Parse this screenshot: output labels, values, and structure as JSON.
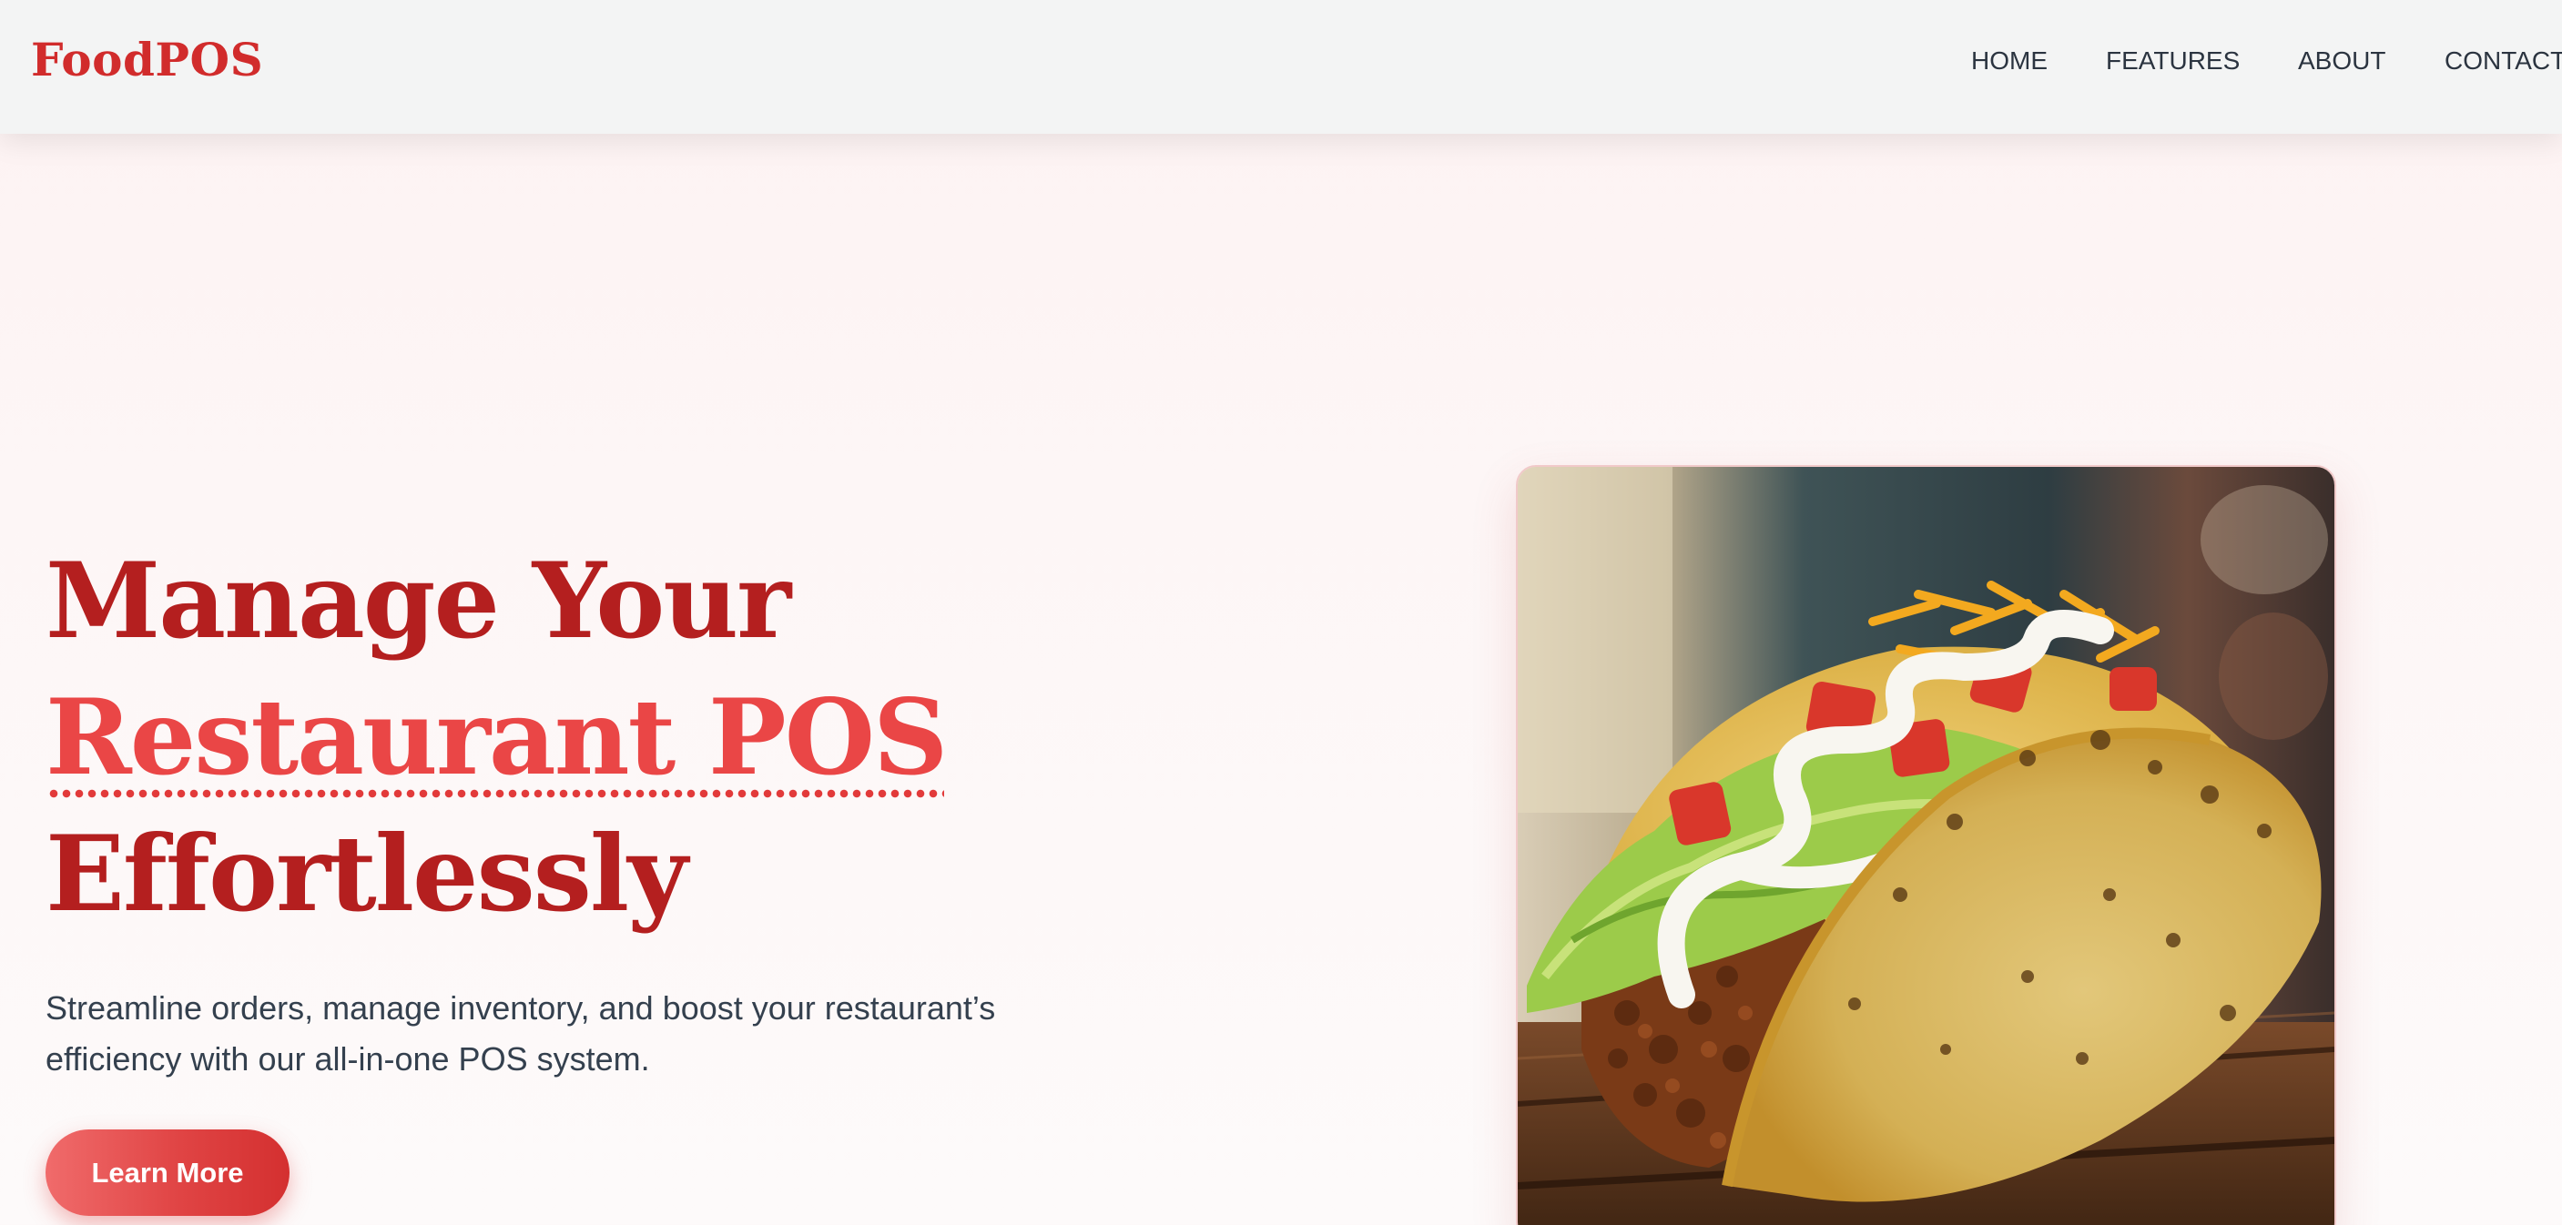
{
  "brand": {
    "name": "FoodPOS"
  },
  "nav": {
    "items": [
      {
        "label": "HOME"
      },
      {
        "label": "FEATURES"
      },
      {
        "label": "ABOUT"
      },
      {
        "label": "CONTACT"
      }
    ]
  },
  "hero": {
    "title_line1": "Manage Your",
    "title_highlight": "Restaurant POS",
    "title_line3": "Effortlessly",
    "subtitle": "Streamline orders, manage inventory, and boost your restaurant’s efficiency with our all-in-one POS system.",
    "cta_label": "Learn More",
    "image_subject": "taco-photo"
  },
  "colors": {
    "brand_red": "#d12c2c",
    "title_dark_red": "#b41f1f",
    "title_accent_red": "#ea4646",
    "nav_text": "#2b3440",
    "navbar_bg": "#f3f4f4",
    "page_bg": "#fdf2f2"
  }
}
